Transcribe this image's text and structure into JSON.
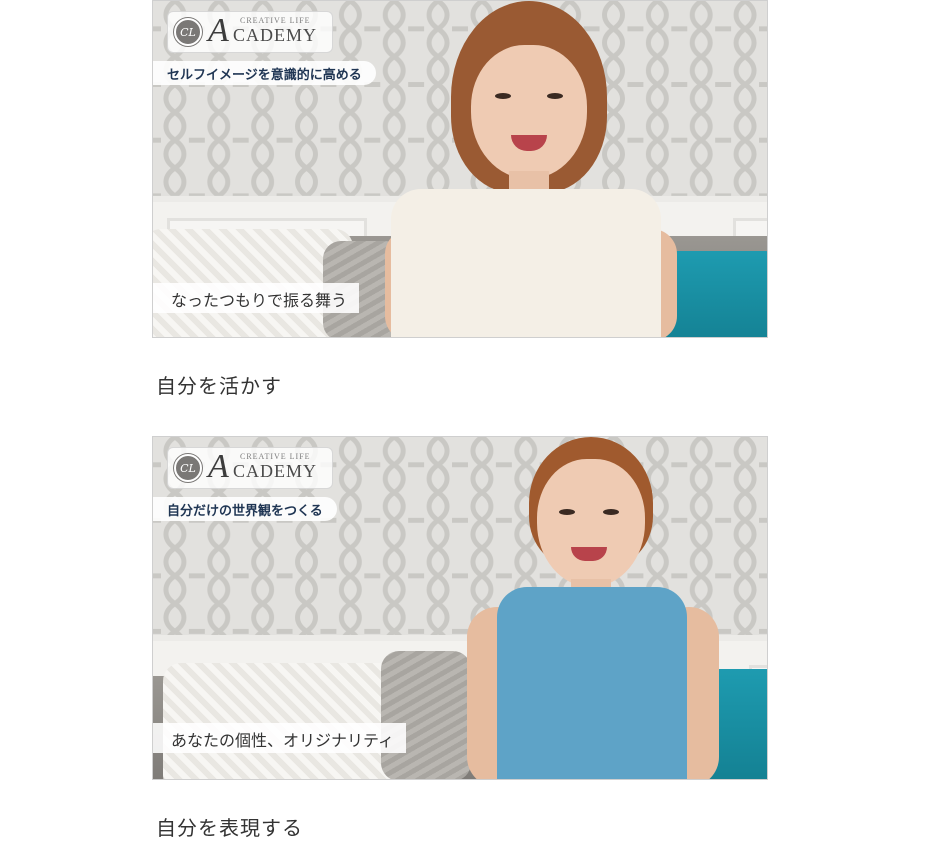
{
  "sections": [
    {
      "video": {
        "logo_emblem": "CL",
        "logo_small": "CREATIVE LIFE",
        "logo_word": "CADEMY",
        "logo_initial": "A",
        "topic": "セルフイメージを意識的に高める",
        "caption": "なったつもりで振る舞う"
      },
      "heading": "自分を活かす"
    },
    {
      "video": {
        "logo_emblem": "CL",
        "logo_small": "CREATIVE LIFE",
        "logo_word": "CADEMY",
        "logo_initial": "A",
        "topic": "自分だけの世界観をつくる",
        "caption": "あなたの個性、オリジナリティ"
      },
      "heading": "自分を表現する"
    }
  ],
  "colors": {
    "topic_text": "#1f3553",
    "sofa_accent": "#1e9bb0",
    "top_white_outfit": "#f4efe6",
    "denim_outfit": "#5ea3c7"
  }
}
